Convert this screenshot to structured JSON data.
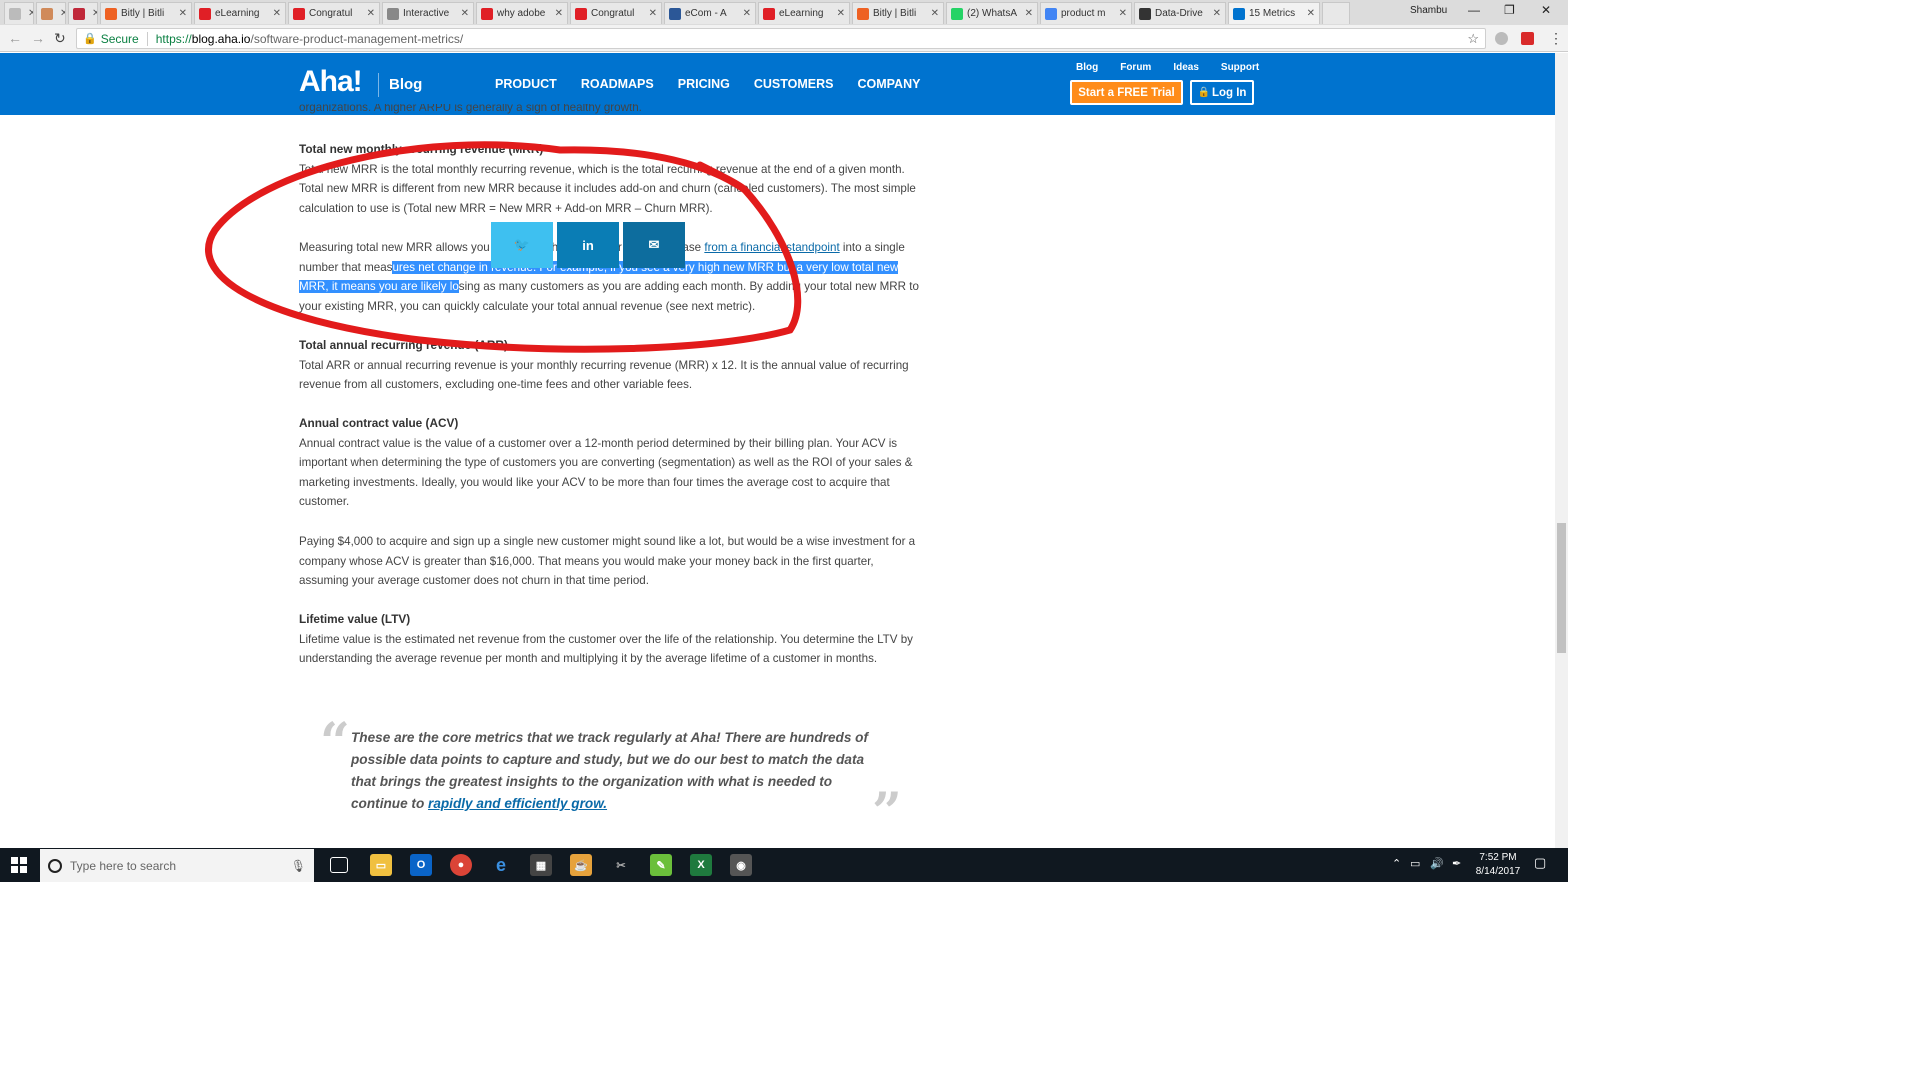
{
  "browser": {
    "tabs": [
      {
        "title": "",
        "color": "#bbbbbb"
      },
      {
        "title": "",
        "color": "#d08a5a"
      },
      {
        "title": "",
        "color": "#c0283a"
      },
      {
        "title": "Bitly | Bitli",
        "color": "#ee6123"
      },
      {
        "title": "eLearning",
        "color": "#e01f26"
      },
      {
        "title": "Congratul",
        "color": "#e01f26"
      },
      {
        "title": "Interactive",
        "color": "#888888"
      },
      {
        "title": "why adobe",
        "color": "#e01f26"
      },
      {
        "title": "Congratul",
        "color": "#e01f26"
      },
      {
        "title": "eCom - A",
        "color": "#2b5797"
      },
      {
        "title": "eLearning",
        "color": "#e01f26"
      },
      {
        "title": "Bitly | Bitli",
        "color": "#ee6123"
      },
      {
        "title": "(2) WhatsA",
        "color": "#25d366"
      },
      {
        "title": "product m",
        "color": "#4285f4"
      },
      {
        "title": "Data-Drive",
        "color": "#333333"
      },
      {
        "title": "15 Metrics",
        "color": "#0073cf"
      }
    ],
    "user": "Shambu",
    "secure_label": "Secure",
    "url_proto": "https://",
    "url_host": "blog.aha.io",
    "url_path": "/software-product-management-metrics/"
  },
  "site": {
    "logo": "Aha!",
    "blog_label": "Blog",
    "nav": [
      "PRODUCT",
      "ROADMAPS",
      "PRICING",
      "CUSTOMERS",
      "COMPANY"
    ],
    "top_links": [
      "Blog",
      "Forum",
      "Ideas",
      "Support"
    ],
    "trial_button": "Start a FREE Trial",
    "login_button": "Log In",
    "brand_color": "#0073cf",
    "accent_color": "#ff8c1a"
  },
  "article": {
    "cut_line": "organizations. A higher ARPU is generally a sign of healthy growth.",
    "s1_heading": "Total new monthly recurring revenue (MRR)",
    "s1_body": "Total new MRR is the total monthly recurring revenue, which is the total recurring revenue at the end of a given month. Total new MRR is different from new MRR because it includes add-on and churn (canceled customers). The most simple calculation to use is (Total new MRR = New MRR + Add-on MRR – Churn MRR).",
    "s1_p2_a": "Measuring total new MRR allows you to view the health of your customer base ",
    "s1_p2_link": "from a financial standpoint",
    "s1_p2_b": " into a single number that measures net change in revenue. For example, if you see a very high new MRR but a very low total new MRR, it means you are likely losing as many customers as you are adding each month. By adding your total new MRR to your existing MRR, you can quickly calculate your total annual revenue (see next metric).",
    "s2_heading": "Total annual recurring revenue (ARR)",
    "s2_body": "Total ARR or annual recurring revenue is your monthly recurring revenue (MRR) x 12. It is the annual value of recurring revenue from all customers, excluding one-time fees and other variable fees.",
    "s3_heading": "Annual contract value (ACV)",
    "s3_body": "Annual contract value is the value of a customer over a 12-month period determined by their billing plan. Your ACV is important when determining the type of customers you are converting (segmentation) as well as the ROI of your sales & marketing investments. Ideally, you would like your ACV to be more than four times the average cost to acquire that customer.",
    "s3_p2": "Paying $4,000 to acquire and sign up a single new customer might sound like a lot, but would be a wise investment for a company whose ACV is greater than $16,000. That means you would make your money back in the first quarter, assuming your average customer does not churn in that time period.",
    "s4_heading": "Lifetime value (LTV)",
    "s4_body": "Lifetime value is the estimated net revenue from the customer over the life of the relationship. You determine the LTV by understanding the average revenue per month and multiplying it by the average lifetime of a customer in months.",
    "quote_text": "These are the core metrics that we track regularly at Aha! There are hundreds of possible data points to capture and study, but we do our best to match the data that brings the greatest insights to the organization with what is needed to continue to ",
    "quote_link": "rapidly and efficiently grow."
  },
  "share": [
    {
      "icon": "twitter-icon",
      "glyph": "🐦",
      "color": "#3ec0f0"
    },
    {
      "icon": "linkedin-icon",
      "glyph": "in",
      "color": "#0a7db5"
    },
    {
      "icon": "email-icon",
      "glyph": "✉",
      "color": "#0d6d9e"
    }
  ],
  "taskbar": {
    "search_placeholder": "Type here to search",
    "time": "7:52 PM",
    "date": "8/14/2017"
  }
}
